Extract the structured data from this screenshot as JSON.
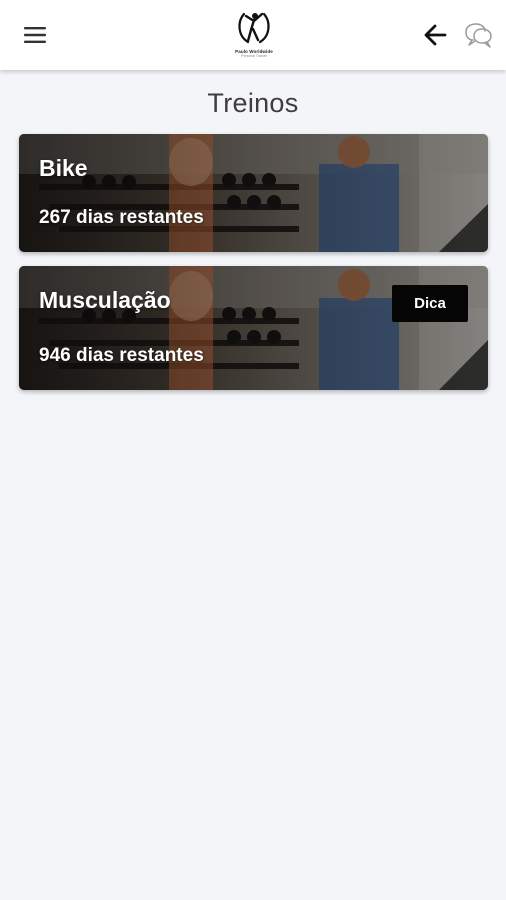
{
  "header": {
    "menu_icon": "hamburger-menu-icon",
    "logo_name": "Paulo Worldwide",
    "logo_sub": "Personal Trainer",
    "back_icon": "arrow-left-icon",
    "chat_icon": "chat-bubbles-icon"
  },
  "page": {
    "title": "Treinos"
  },
  "workouts": [
    {
      "name": "Bike",
      "remaining": "267 dias restantes",
      "tip_label": ""
    },
    {
      "name": "Musculação",
      "remaining": "946 dias restantes",
      "tip_label": "Dica"
    }
  ],
  "colors": {
    "background": "#f4f5f9",
    "topbar": "#ffffff",
    "tip_button": "#050505",
    "card_text": "#ffffff"
  }
}
